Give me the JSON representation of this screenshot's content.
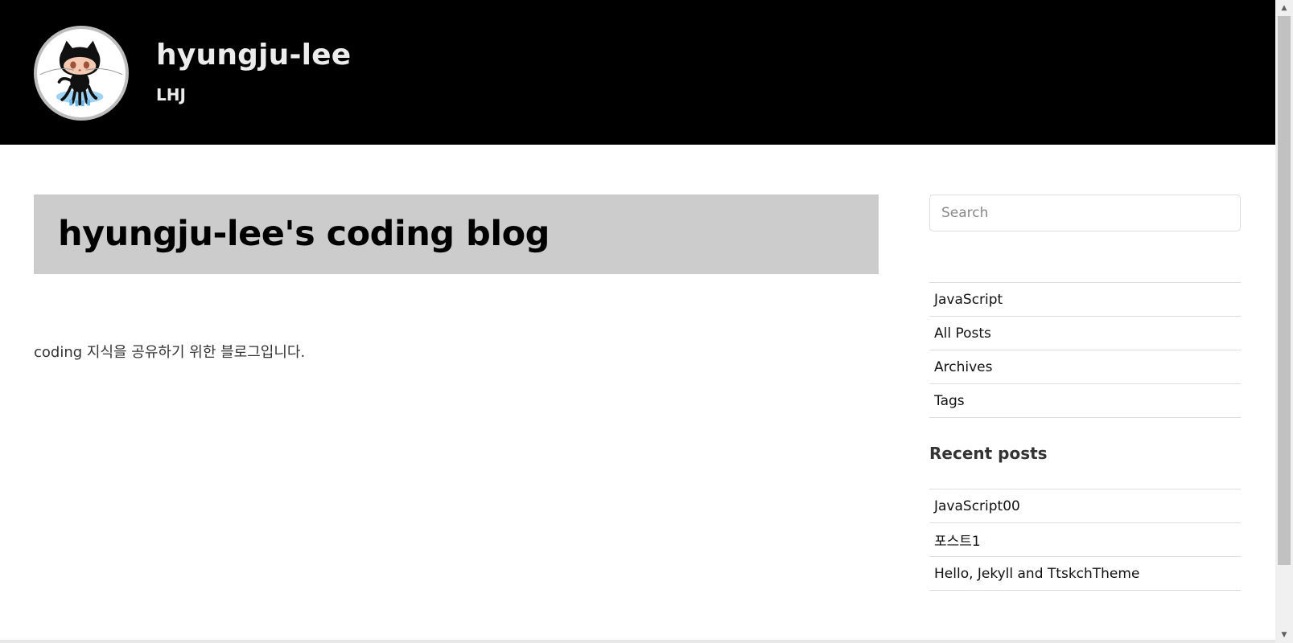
{
  "header": {
    "avatar_icon": "octocat-icon",
    "title": "hyungju-lee",
    "subtitle": "LHJ"
  },
  "main": {
    "page_title": "hyungju-lee's coding blog",
    "intro": "coding 지식을 공유하기 위한 블로그입니다."
  },
  "sidebar": {
    "search": {
      "placeholder": "Search",
      "value": ""
    },
    "menu": [
      {
        "label": "JavaScript"
      },
      {
        "label": "All Posts"
      },
      {
        "label": "Archives"
      },
      {
        "label": "Tags"
      }
    ],
    "recent_heading": "Recent posts",
    "recent_posts": [
      {
        "label": "JavaScript00"
      },
      {
        "label": "포스트1"
      },
      {
        "label": "Hello, Jekyll and TtskchTheme"
      }
    ]
  },
  "colors": {
    "header_bg": "#000000",
    "banner_bg": "#cccccc",
    "divider": "#dddddd"
  }
}
